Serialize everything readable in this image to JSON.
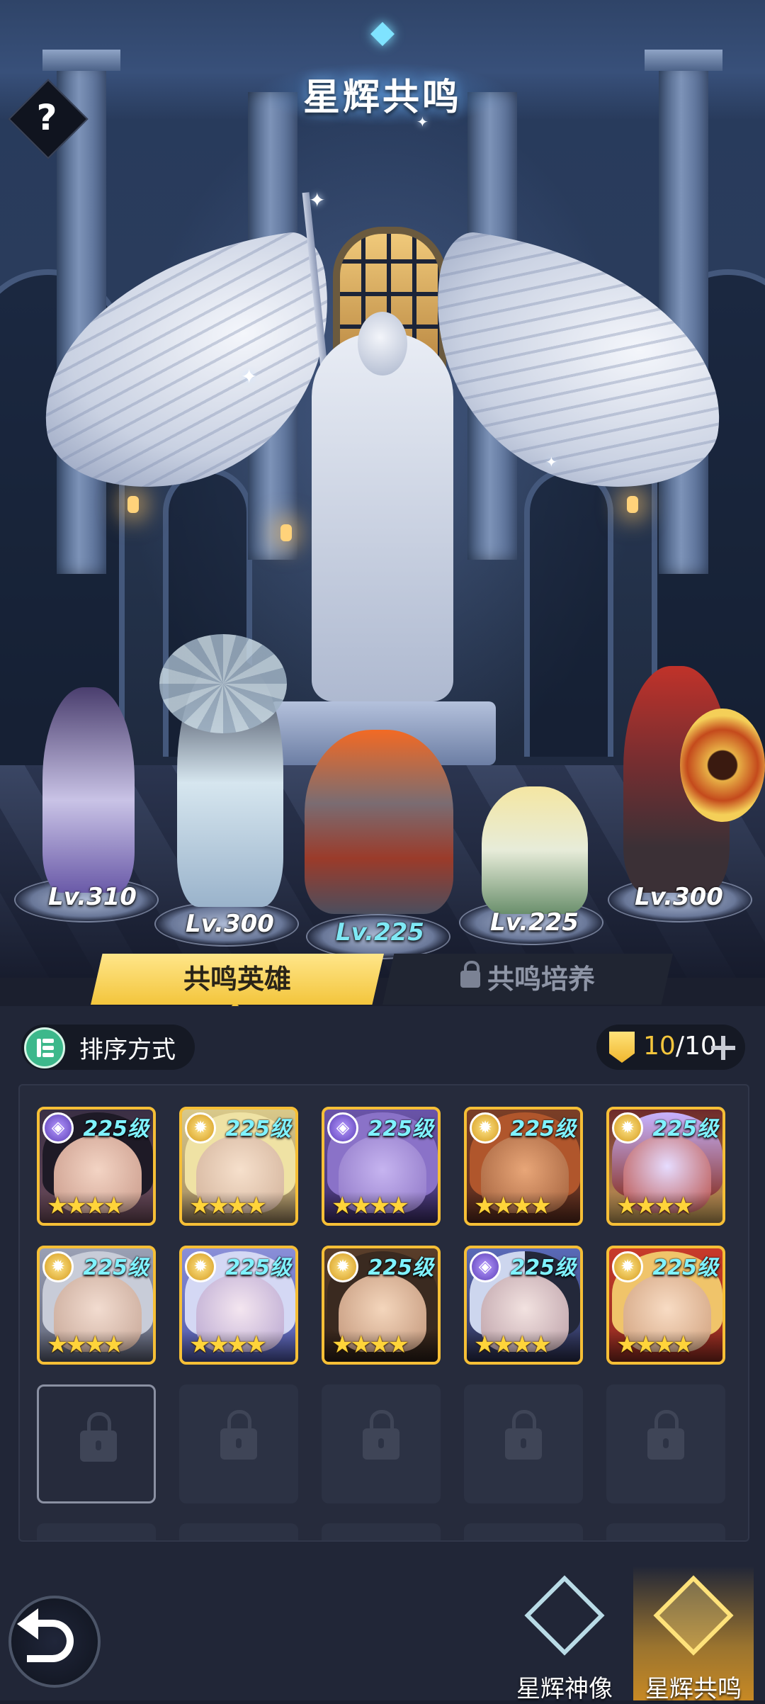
{
  "header": {
    "title": "星辉共鸣",
    "help_label": "?"
  },
  "stage": {
    "heroes": [
      {
        "level": "Lv.310"
      },
      {
        "level": "Lv.300"
      },
      {
        "level": "Lv.225"
      },
      {
        "level": "Lv.225"
      },
      {
        "level": "Lv.300"
      }
    ]
  },
  "tabs": [
    {
      "label": "共鸣英雄",
      "active": true
    },
    {
      "label": "共鸣培养",
      "locked": true
    }
  ],
  "toolbar": {
    "sort_label": "排序方式",
    "count_current": "10",
    "count_sep": "/",
    "count_max": "10"
  },
  "hero_cards": [
    {
      "level": "225级",
      "stars": "★★★★",
      "badge": "purple"
    },
    {
      "level": "225级",
      "stars": "★★★★",
      "badge": "gold"
    },
    {
      "level": "225级",
      "stars": "★★★★",
      "badge": "purple"
    },
    {
      "level": "225级",
      "stars": "★★★★",
      "badge": "gold"
    },
    {
      "level": "225级",
      "stars": "★★★★",
      "badge": "gold"
    },
    {
      "level": "225级",
      "stars": "★★★★",
      "badge": "gold"
    },
    {
      "level": "225级",
      "stars": "★★★★",
      "badge": "gold"
    },
    {
      "level": "225级",
      "stars": "★★★★",
      "badge": "gold"
    },
    {
      "level": "225级",
      "stars": "★★★★",
      "badge": "purple"
    },
    {
      "level": "225级",
      "stars": "★★★★",
      "badge": "gold"
    }
  ],
  "bottom_nav": [
    {
      "label": "星辉神像",
      "active": false
    },
    {
      "label": "星辉共鸣",
      "active": true
    }
  ]
}
